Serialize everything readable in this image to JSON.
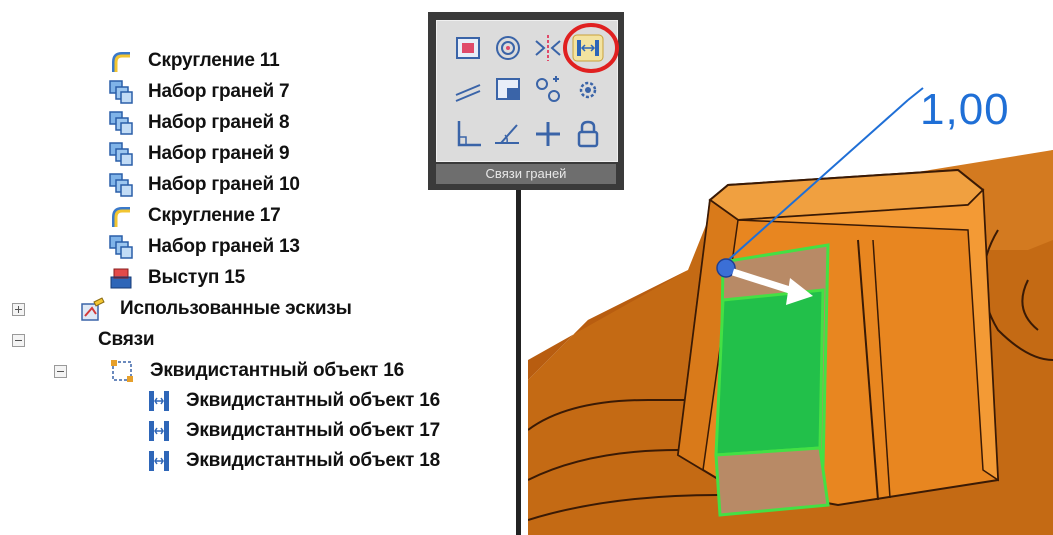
{
  "tree": {
    "items": [
      {
        "label": "Скругление 11",
        "icon": "fillet-icon"
      },
      {
        "label": "Набор граней 7",
        "icon": "face-set-icon"
      },
      {
        "label": "Набор граней 8",
        "icon": "face-set-icon"
      },
      {
        "label": "Набор граней 9",
        "icon": "face-set-icon"
      },
      {
        "label": "Набор граней 10",
        "icon": "face-set-icon"
      },
      {
        "label": "Скругление 17",
        "icon": "fillet-icon"
      },
      {
        "label": "Набор граней 13",
        "icon": "face-set-icon"
      },
      {
        "label": "Выступ 15",
        "icon": "boss-icon"
      },
      {
        "label": "Использованные эскизы",
        "icon": "sketches-icon"
      },
      {
        "label": "Связи",
        "icon": ""
      },
      {
        "label": "Эквидистантный объект 16",
        "icon": "offset-group-icon"
      },
      {
        "label": "Эквидистантный объект 16",
        "icon": "offset-relation-icon"
      },
      {
        "label": "Эквидистантный объект 17",
        "icon": "offset-relation-icon"
      },
      {
        "label": "Эквидистантный объект 18",
        "icon": "offset-relation-icon"
      }
    ]
  },
  "toolbar": {
    "caption": "Связи граней",
    "buttons": [
      "coincident-face-icon",
      "concentric-icon",
      "symmetric-icon",
      "offset-face-icon",
      "parallel-icon",
      "tangent-icon",
      "fix-distance-icon",
      "gear-icon",
      "perpendicular-icon",
      "angle-icon",
      "crosshair-icon",
      "lock-icon"
    ],
    "highlight_color": "#e02020"
  },
  "scene": {
    "dimension_value": "1,00",
    "dimension_color": "#1f6fd6",
    "part_color": "#d97a1a",
    "selected_face_color": "#22c04a"
  }
}
